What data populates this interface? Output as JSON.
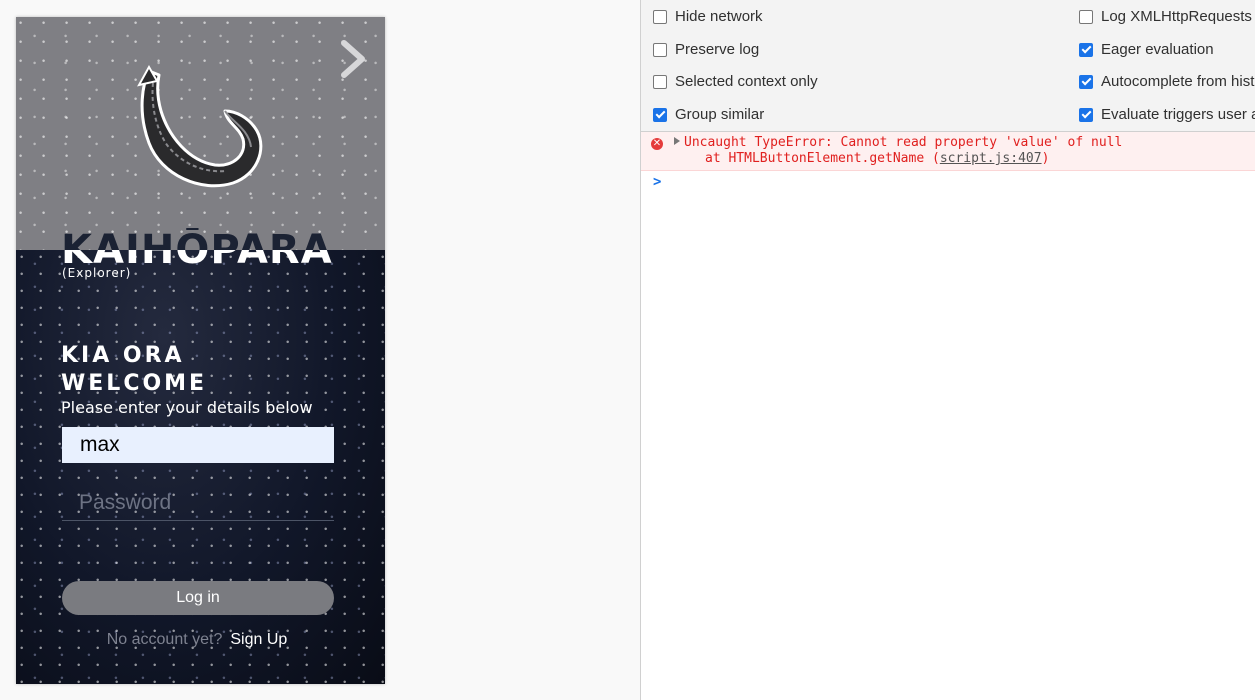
{
  "app": {
    "brand_name": "KAIHŌPARA",
    "brand_subtitle": "(Explorer)",
    "greeting_line1": "KIA ORA",
    "greeting_line2": "WELCOME",
    "instructions": "Please enter your details below",
    "username_value": "max",
    "password_placeholder": "Password",
    "login_label": "Log in",
    "signup_prompt": "No account yet?",
    "signup_link": "Sign Up",
    "logo_icon": "fish-hook-icon",
    "next_icon": "chevron-right-icon"
  },
  "devtools": {
    "options": [
      {
        "label": "Hide network",
        "checked": false
      },
      {
        "label": "Preserve log",
        "checked": false
      },
      {
        "label": "Selected context only",
        "checked": false
      },
      {
        "label": "Group similar",
        "checked": true
      },
      {
        "label": "Log XMLHttpRequests",
        "checked": false
      },
      {
        "label": "Eager evaluation",
        "checked": true
      },
      {
        "label": "Autocomplete from hist",
        "checked": true
      },
      {
        "label": "Evaluate triggers user a",
        "checked": true
      }
    ],
    "error": {
      "message": "Uncaught TypeError: Cannot read property 'value' of null",
      "stack_prefix": "at HTMLButtonElement.getName (",
      "source_link": "script.js:407",
      "stack_suffix": ")"
    },
    "prompt_symbol": ">",
    "colors": {
      "error_text": "#e0201f",
      "error_bg": "#fef0f0",
      "checkbox_on": "#1a73e8"
    }
  }
}
